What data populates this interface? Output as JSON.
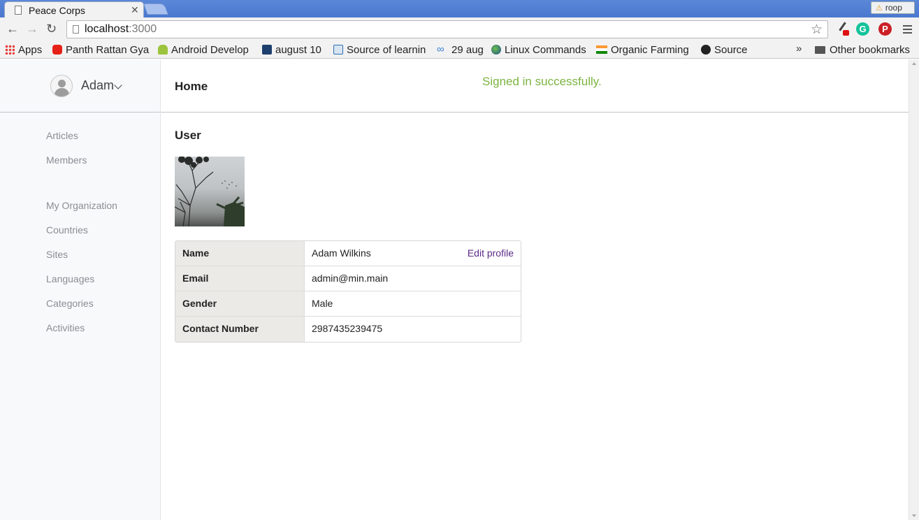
{
  "browser": {
    "tab_title": "Peace Corps",
    "profile_name": "roop",
    "url_host": "localhost",
    "url_port": ":3000",
    "bookmarks": [
      {
        "label": "Apps",
        "icon": "apps-grid-icon"
      },
      {
        "label": "Panth Rattan Gya",
        "icon": "youtube-icon"
      },
      {
        "label": "Android Develop",
        "icon": "android-icon"
      },
      {
        "label": "august 10",
        "icon": "qut-icon"
      },
      {
        "label": "Source of learnin",
        "icon": "d-icon"
      },
      {
        "label": "29 aug",
        "icon": "infinity-icon"
      },
      {
        "label": "Linux Commands",
        "icon": "globe-icon"
      },
      {
        "label": "Organic Farming",
        "icon": "india-flag-icon"
      },
      {
        "label": "Source",
        "icon": "github-icon"
      }
    ],
    "overflow": "»",
    "other_bookmarks": "Other bookmarks"
  },
  "sidebar": {
    "user_name": "Adam",
    "nav_group_1": [
      "Articles",
      "Members"
    ],
    "nav_group_2": [
      "My Organization",
      "Countries",
      "Sites",
      "Languages",
      "Categories",
      "Activities"
    ]
  },
  "header": {
    "title": "Home",
    "flash": "Signed in successfully."
  },
  "main": {
    "section_title": "User",
    "profile_rows": [
      {
        "label": "Name",
        "value": "Adam Wilkins"
      },
      {
        "label": "Email",
        "value": "admin@min.main"
      },
      {
        "label": "Gender",
        "value": "Male"
      },
      {
        "label": "Contact Number",
        "value": "2987435239475"
      }
    ],
    "edit_profile": "Edit profile"
  },
  "colors": {
    "flash_success": "#7cb342",
    "link": "#5b2a86",
    "sidebar_bg": "#f8f9fb"
  }
}
